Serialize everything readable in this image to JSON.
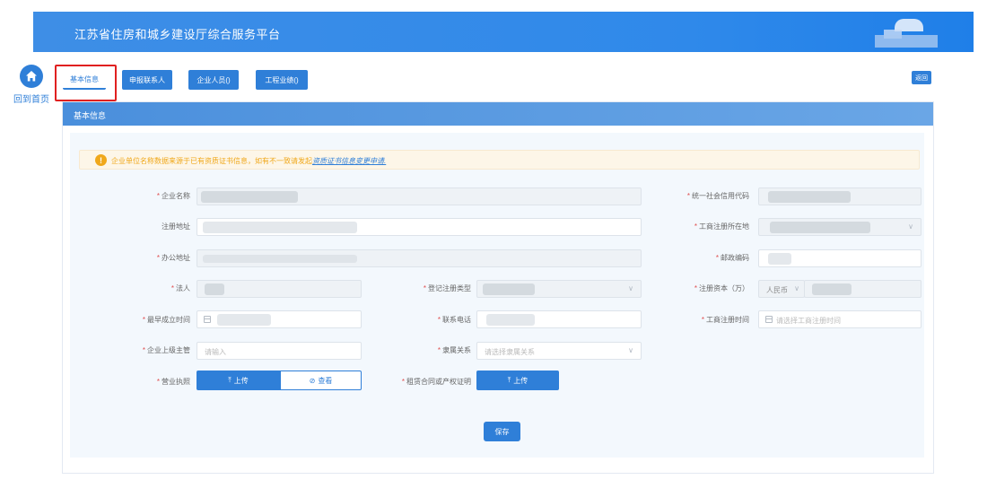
{
  "header": {
    "title": "江苏省住房和城乡建设厅综合服务平台"
  },
  "nav": {
    "home_label": "回到首页"
  },
  "tabs": [
    {
      "label": "基本信息",
      "active": true
    },
    {
      "label": "申报联系人",
      "active": false
    },
    {
      "label": "企业人员()",
      "active": false
    },
    {
      "label": "工程业绩()",
      "active": false
    }
  ],
  "toolbar": {
    "return_label": "返回"
  },
  "panel": {
    "title": "基本信息"
  },
  "notice": {
    "text": "企业单位名称数据来源于已有资质证书信息，如有不一致请发起",
    "link": "资质证书信息变更申请",
    "suffix": "."
  },
  "form": {
    "company_name": {
      "label": "企业名称",
      "required": true,
      "value": ""
    },
    "credit_code": {
      "label": "统一社会信用代码",
      "required": true,
      "value": ""
    },
    "reg_address": {
      "label": "注册地址",
      "required": false,
      "value": ""
    },
    "business_reg_location": {
      "label": "工商注册所在地",
      "required": true,
      "value": ""
    },
    "office_address": {
      "label": "办公地址",
      "required": true,
      "value": ""
    },
    "postal_code": {
      "label": "邮政编码",
      "required": true,
      "value": ""
    },
    "legal_person": {
      "label": "法人",
      "required": true,
      "value": ""
    },
    "registration_type": {
      "label": "登记注册类型",
      "required": true,
      "value": ""
    },
    "registered_capital": {
      "label": "注册资本（万）",
      "required": true,
      "currency": "人民币",
      "value": ""
    },
    "earliest_established": {
      "label": "最早成立时间",
      "required": true,
      "value": ""
    },
    "phone": {
      "label": "联系电话",
      "required": true,
      "value": ""
    },
    "business_reg_time": {
      "label": "工商注册时间",
      "required": true,
      "placeholder": "请选择工商注册时间"
    },
    "superior_authority": {
      "label": "企业上级主管",
      "required": true,
      "placeholder": "请输入"
    },
    "affiliation": {
      "label": "隶属关系",
      "required": true,
      "placeholder": "请选择隶属关系"
    },
    "business_license": {
      "label": "营业执照",
      "required": true,
      "upload_label": "上传",
      "view_label": "查看"
    },
    "lease_contract": {
      "label": "租赁合同或产权证明",
      "required": true,
      "upload_label": "上传"
    },
    "save_label": "保存"
  },
  "colors": {
    "primary": "#2f7fd8",
    "warning": "#f0a81b",
    "highlight": "#e02020"
  }
}
